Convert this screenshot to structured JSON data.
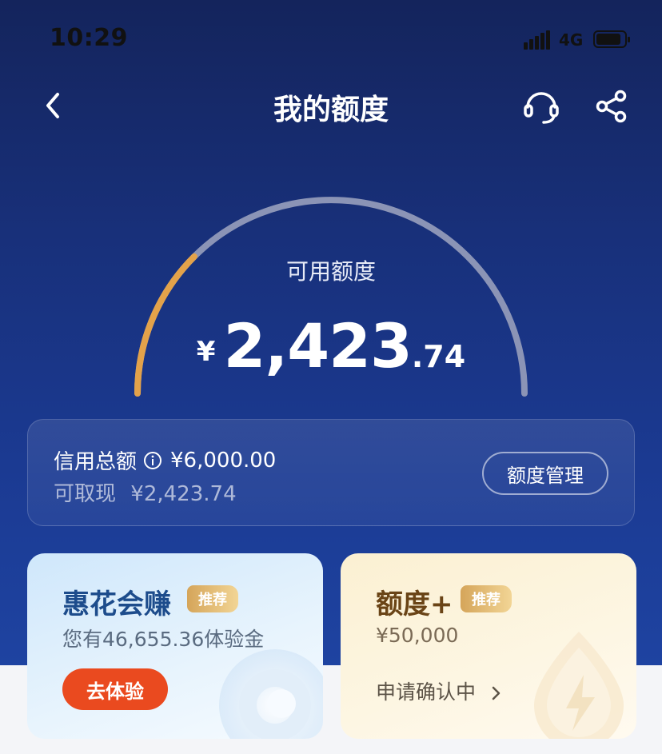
{
  "status_bar": {
    "time": "10:29",
    "network": "4G"
  },
  "nav": {
    "title": "我的额度",
    "back_icon": "back-icon",
    "support_icon": "headset-icon",
    "share_icon": "share-icon"
  },
  "gauge": {
    "label": "可用额度",
    "currency": "¥",
    "amount_int": "2,423",
    "amount_dec": ".74",
    "used_fraction": 0.25
  },
  "limit": {
    "total_label": "信用总额",
    "total_value": "¥6,000.00",
    "cash_label": "可取现",
    "cash_value": "¥2,423.74",
    "manage_button": "额度管理"
  },
  "promos": [
    {
      "title": "惠花会赚",
      "tag": "推荐",
      "subtitle": "您有46,655.36体验金",
      "action": "去体验"
    },
    {
      "title": "额度+",
      "tag": "推荐",
      "subtitle": "¥50,000",
      "action": "申请确认中"
    }
  ],
  "colors": {
    "hero_top": "#14245c",
    "hero_bottom": "#1e43a1",
    "gauge_progress": "#e3a24a",
    "gauge_track": "#8b94b6",
    "cta": "#ea4a1f"
  }
}
